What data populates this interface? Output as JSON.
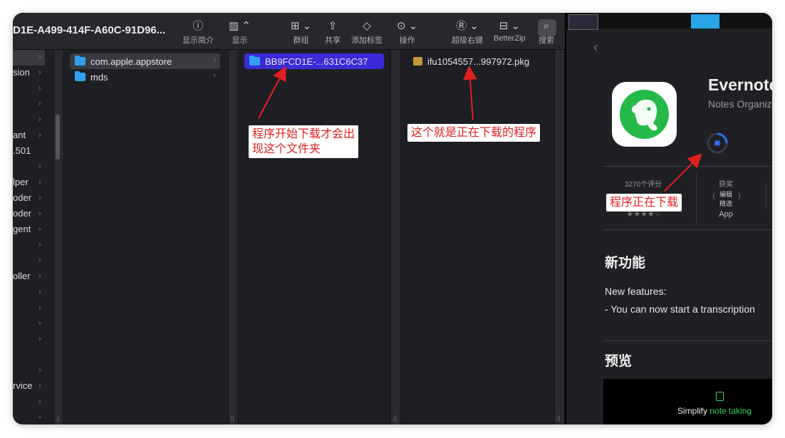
{
  "finder": {
    "window_title": "D1E-A499-414F-A60C-91D96...",
    "toolbar": [
      {
        "icon": "info-icon",
        "glyph": "ⓘ",
        "label": "显示简介"
      },
      {
        "icon": "column-view-icon",
        "glyph": "▥ ⌃",
        "label": "显示"
      },
      {
        "icon": "group-icon",
        "glyph": "⊞ ⌄",
        "label": "群组"
      },
      {
        "icon": "share-icon",
        "glyph": "⇪",
        "label": "共享"
      },
      {
        "icon": "tag-icon",
        "glyph": "◇",
        "label": "添加标签"
      },
      {
        "icon": "action-icon",
        "glyph": "⊙ ⌄",
        "label": "操作"
      },
      {
        "icon": "superright-icon",
        "glyph": "Ⓡ ⌄",
        "label": "超级右键"
      },
      {
        "icon": "betterzip-icon",
        "glyph": "⊟ ⌄",
        "label": "BetterZip"
      },
      {
        "icon": "search-icon",
        "glyph": "⌕",
        "label": "搜索"
      }
    ],
    "sidebar_fragments": [
      "sion",
      "ant",
      ".501",
      "lper",
      "oder",
      "oder",
      "gent",
      "oller",
      "rvice"
    ],
    "column2": [
      {
        "name": "com.apple.appstore",
        "selected": true
      },
      {
        "name": "mds",
        "selected": false
      }
    ],
    "column3": [
      {
        "name": "BB9FCD1E-...631C6C37",
        "selected": true
      }
    ],
    "column4": [
      {
        "name": "ifu1054557...997972.pkg",
        "selected": false
      }
    ]
  },
  "annotations": {
    "folder_note": "程序开始下载才会出\n现这个文件夹",
    "pkg_note": "这个就是正在下载的程序",
    "download_note": "程序正在下载",
    "color": "#e02020"
  },
  "appstore": {
    "app_name": "Evernote",
    "app_subtitle": "Notes Organiz",
    "ratings_count": "3270个评分",
    "award_label": "获奖",
    "award_badge_line1": "编辑",
    "award_badge_line2": "精选",
    "award_kind": "App",
    "stars": "★★★★☆",
    "whats_new_title": "新功能",
    "whats_new_line1": "New features:",
    "whats_new_line2": "- You can now start a transcription",
    "preview_title": "预览",
    "preview_text_a": "Simplify ",
    "preview_text_b": "note taking",
    "back_glyph": "‹"
  }
}
